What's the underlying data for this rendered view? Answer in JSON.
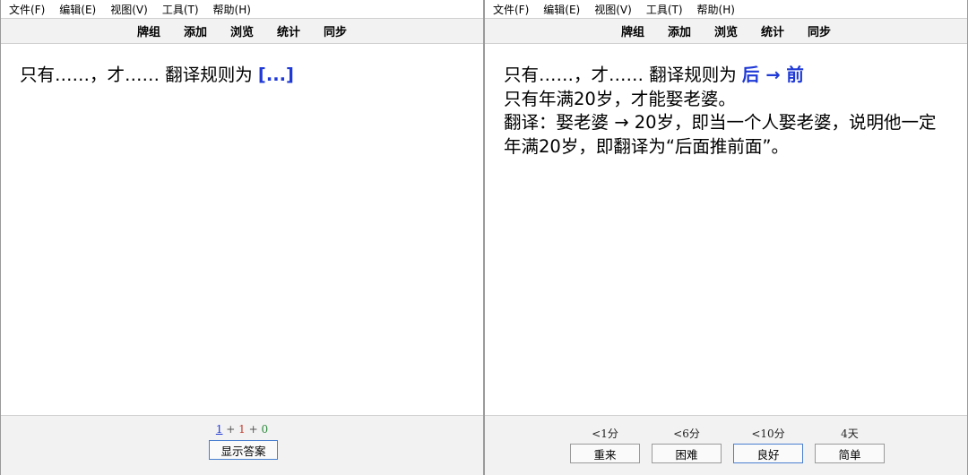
{
  "left_window": {
    "menu": [
      "文件(F)",
      "编辑(E)",
      "视图(V)",
      "工具(T)",
      "帮助(H)"
    ],
    "toolbar": [
      "牌组",
      "添加",
      "浏览",
      "统计",
      "同步"
    ],
    "card": {
      "question_prefix": "只有……，才…… 翻译规则为 ",
      "cloze": "[...]"
    },
    "counts": {
      "new": "1",
      "sep1": " + ",
      "learn": "1",
      "sep2": " + ",
      "review": "0"
    },
    "show_answer_label": "显示答案"
  },
  "right_window": {
    "menu": [
      "文件(F)",
      "编辑(E)",
      "视图(V)",
      "工具(T)",
      "帮助(H)"
    ],
    "toolbar": [
      "牌组",
      "添加",
      "浏览",
      "统计",
      "同步"
    ],
    "card": {
      "question_prefix": "只有……，才…… 翻译规则为 ",
      "cloze_answer": "后 → 前",
      "lines": [
        "只有年满20岁，才能娶老婆。",
        "翻译：娶老婆 → 20岁，即当一个人娶老婆，说明他一定",
        "年满20岁，即翻译为“后面推前面”。"
      ]
    },
    "answer_buttons": [
      {
        "interval": "<1分",
        "label": "重来"
      },
      {
        "interval": "<6分",
        "label": "困难"
      },
      {
        "interval": "<10分",
        "label": "良好"
      },
      {
        "interval": "4天",
        "label": "简单"
      }
    ]
  },
  "colors": {
    "cloze": "#1f39d6",
    "count_new": "#1f39d6",
    "count_learn": "#c0392b",
    "count_review": "#2e8b3d",
    "bar_bg": "#f2f2f2"
  }
}
